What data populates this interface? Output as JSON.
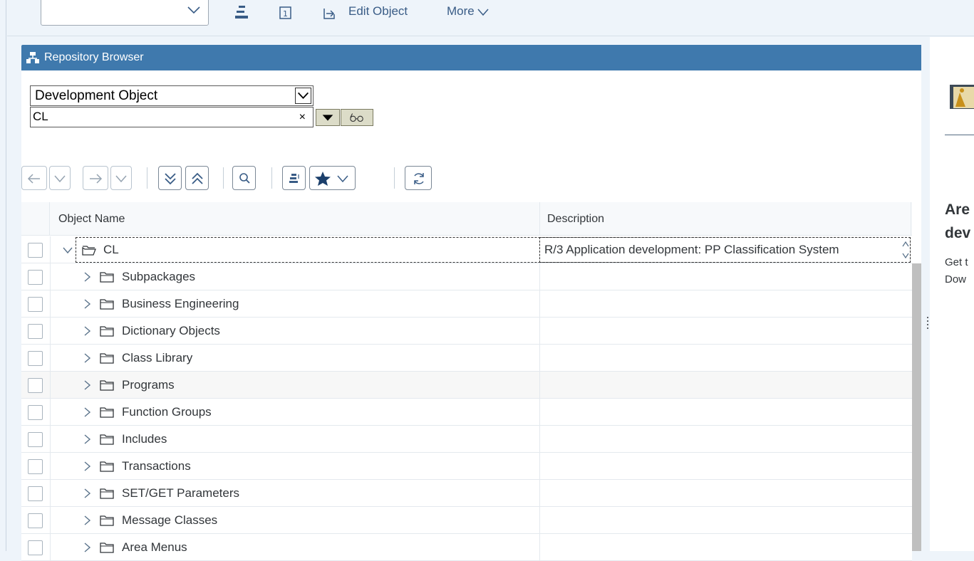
{
  "top_toolbar": {
    "combo_value": "",
    "edit_object_label": "Edit Object",
    "more_label": "More"
  },
  "panel": {
    "title": "Repository Browser",
    "object_type": "Development Object",
    "object_name": "CL",
    "clear_glyph": "×"
  },
  "table": {
    "col_name": "Object Name",
    "col_desc": "Description",
    "root": {
      "label": "CL",
      "desc": "R/3 Application development: PP Classification System"
    },
    "nodes": [
      {
        "label": "Subpackages"
      },
      {
        "label": "Business Engineering"
      },
      {
        "label": "Dictionary Objects"
      },
      {
        "label": "Class Library"
      },
      {
        "label": "Programs"
      },
      {
        "label": "Function Groups"
      },
      {
        "label": "Includes"
      },
      {
        "label": "Transactions"
      },
      {
        "label": "SET/GET Parameters"
      },
      {
        "label": "Message Classes"
      },
      {
        "label": "Area Menus"
      }
    ]
  },
  "side_panel": {
    "title_line1": "Are",
    "title_line2": "dev",
    "text1": "Get t",
    "text2": "Dow"
  },
  "colors": {
    "header_blue": "#3f79ad",
    "icon_blue": "#395c86",
    "background": "#eef4fa"
  }
}
